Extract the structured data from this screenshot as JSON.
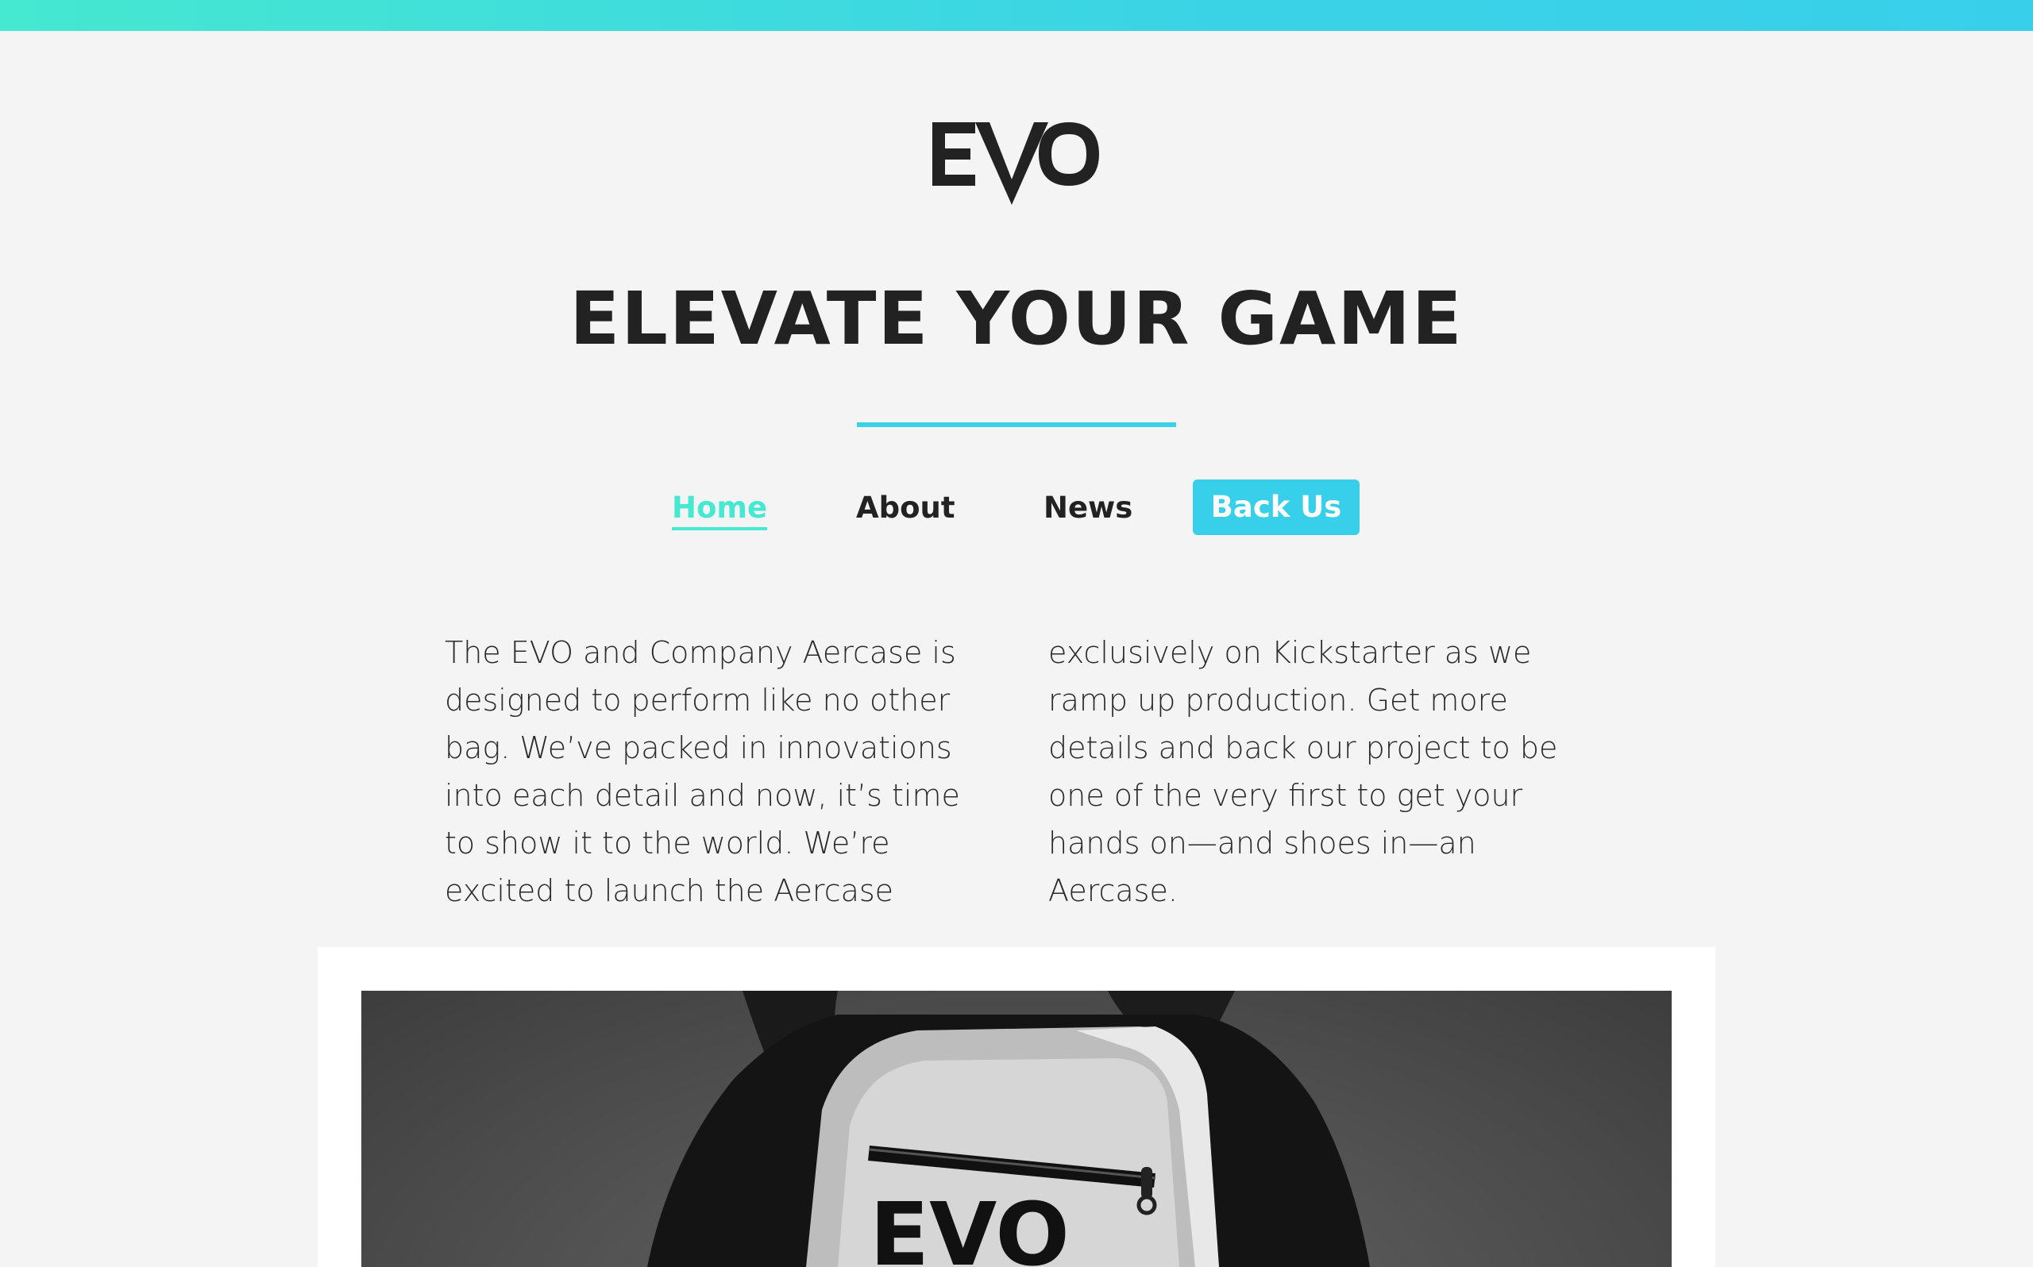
{
  "brand": {
    "logo_text": "EVO",
    "accent": "#45e8d0",
    "accent_blue": "#38cfea"
  },
  "hero": {
    "headline": "ELEVATE YOUR GAME"
  },
  "nav": {
    "items": [
      {
        "label": "Home",
        "active": true
      },
      {
        "label": "About",
        "active": false
      },
      {
        "label": "News",
        "active": false
      }
    ],
    "cta_label": "Back Us"
  },
  "intro": {
    "col1": "The EVO and Company Aercase is designed to perform like no other bag. We’ve packed in innovations into each detail and now, it’s time to show it to the world. We’re excited to launch the Aercase",
    "col2": "exclusively on Kickstarter as we ramp up production. Get more details and back our project to be one of the very first to get your hands on—and shoes in—an Aercase."
  },
  "photo": {
    "icon": "backpack-photo",
    "bag_logo_text": "EVO"
  }
}
